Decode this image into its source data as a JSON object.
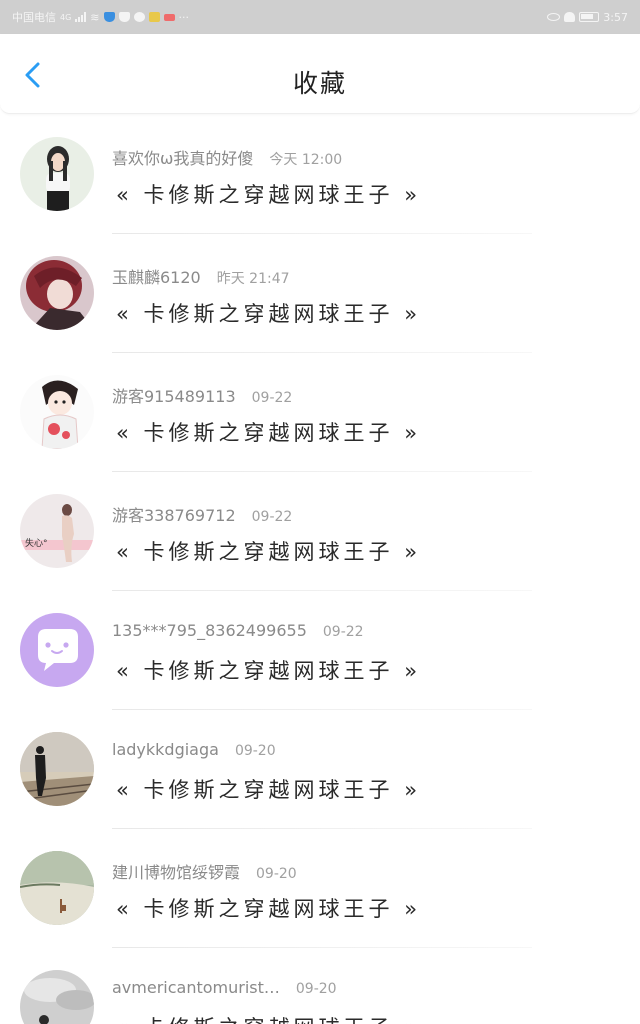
{
  "status_bar": {
    "carrier": "中国电信",
    "signal": "4G",
    "time": "3:57"
  },
  "header": {
    "title": "收藏"
  },
  "favorites": [
    {
      "user": "喜欢你ω我真的好傻",
      "time": "今天 12:00",
      "book": "« 卡修斯之穿越网球王子 »",
      "avatar": "girl-photo-avatar"
    },
    {
      "user": "玉麒麟6120",
      "time": "昨天 21:47",
      "book": "« 卡修斯之穿越网球王子 »",
      "avatar": "red-hair-illustration-avatar"
    },
    {
      "user": "游客915489113",
      "time": "09-22",
      "book": "« 卡修斯之穿越网球王子 »",
      "avatar": "anime-girl-avatar"
    },
    {
      "user": "游客338769712",
      "time": "09-22",
      "book": "« 卡修斯之穿越网球王子 »",
      "avatar": "dancer-avatar",
      "avatar_text": "失心°"
    },
    {
      "user": "135***795_8362499655",
      "time": "09-22",
      "book": "« 卡修斯之穿越网球王子 »",
      "avatar": "chat-bubble-avatar"
    },
    {
      "user": "ladykkdgiaga",
      "time": "09-20",
      "book": "« 卡修斯之穿越网球王子 »",
      "avatar": "railway-silhouette-avatar"
    },
    {
      "user": "建川博物馆绥锣霞",
      "time": "09-20",
      "book": "« 卡修斯之穿越网球王子 »",
      "avatar": "landscape-chair-avatar"
    },
    {
      "user": "avmericantomurist…",
      "time": "09-20",
      "book": "« 卡修斯之穿越网球王子 »",
      "avatar": "cloudy-sky-avatar"
    }
  ],
  "colors": {
    "accent": "#2a9df4",
    "status_bar": "#cfcfcf",
    "chat_avatar": "#c7a8f0"
  }
}
